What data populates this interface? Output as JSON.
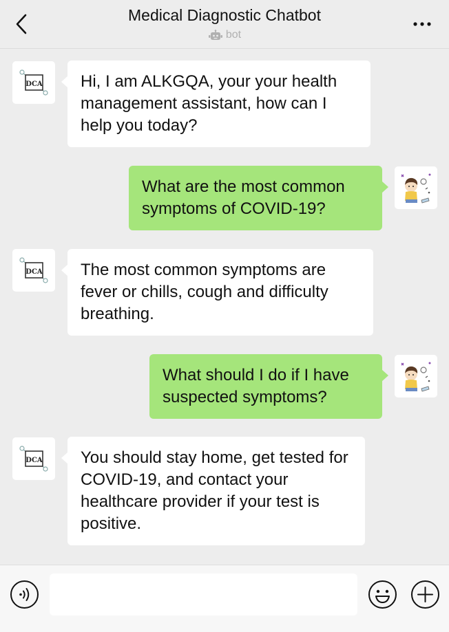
{
  "header": {
    "title": "Medical Diagnostic Chatbot",
    "subtitle": "bot"
  },
  "messages": [
    {
      "sender": "bot",
      "text": "Hi, I am ALKGQA, your your health management assistant, how can I help you today?"
    },
    {
      "sender": "user",
      "text": "What are the most common symptoms of COVID-19?"
    },
    {
      "sender": "bot",
      "text": "The most common symptoms are fever or chills, cough and difficulty breathing."
    },
    {
      "sender": "user",
      "text": "What should I do if I have suspected symptoms?"
    },
    {
      "sender": "bot",
      "text": "You should stay home, get tested for COVID-19, and contact your healthcare provider if your test is positive."
    }
  ],
  "bot_avatar": {
    "logo_text": "DCA"
  },
  "input_bar": {
    "value": "",
    "placeholder": ""
  },
  "icons": {
    "back": "chevron-left-icon",
    "more": "more-dots-icon",
    "bot_badge": "robot-icon",
    "voice": "voice-icon",
    "emoji": "emoji-icon",
    "plus": "plus-icon"
  },
  "colors": {
    "background": "#ededed",
    "user_bubble": "#a5e57b",
    "bot_bubble": "#ffffff"
  }
}
